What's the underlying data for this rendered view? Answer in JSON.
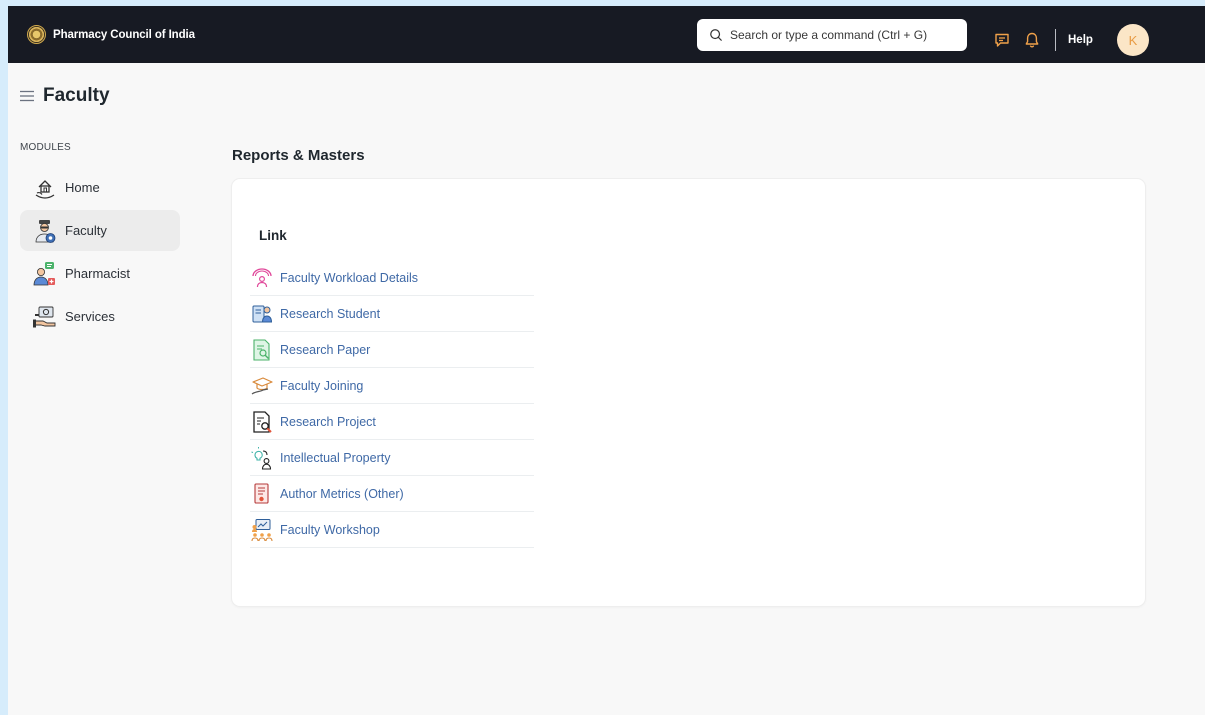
{
  "navbar": {
    "brand": "Pharmacy Council of India",
    "search_placeholder": "Search or type a command (Ctrl + G)",
    "help": "Help",
    "avatar_initial": "K"
  },
  "page": {
    "title": "Faculty"
  },
  "sidebar": {
    "modules_label": "MODULES",
    "items": [
      {
        "label": "Home",
        "icon": "home-icon",
        "active": false
      },
      {
        "label": "Faculty",
        "icon": "faculty-icon",
        "active": true
      },
      {
        "label": "Pharmacist",
        "icon": "pharmacist-icon",
        "active": false
      },
      {
        "label": "Services",
        "icon": "services-icon",
        "active": false
      }
    ]
  },
  "main": {
    "section_title": "Reports & Masters",
    "card_heading": "Link",
    "links": [
      {
        "label": "Faculty Workload Details",
        "icon": "workload-icon"
      },
      {
        "label": "Research Student",
        "icon": "research-student-icon"
      },
      {
        "label": "Research Paper",
        "icon": "research-paper-icon"
      },
      {
        "label": "Faculty Joining",
        "icon": "faculty-joining-icon"
      },
      {
        "label": "Research Project",
        "icon": "research-project-icon"
      },
      {
        "label": "Intellectual Property",
        "icon": "intellectual-property-icon"
      },
      {
        "label": "Author Metrics (Other)",
        "icon": "author-metrics-icon"
      },
      {
        "label": "Faculty Workshop",
        "icon": "faculty-workshop-icon"
      }
    ]
  },
  "colors": {
    "navbar_bg": "#171a23",
    "link": "#3f69a6",
    "avatar_bg": "#fbe6c7",
    "avatar_text": "#e89b43",
    "notification_icons": "#f0a14a"
  }
}
